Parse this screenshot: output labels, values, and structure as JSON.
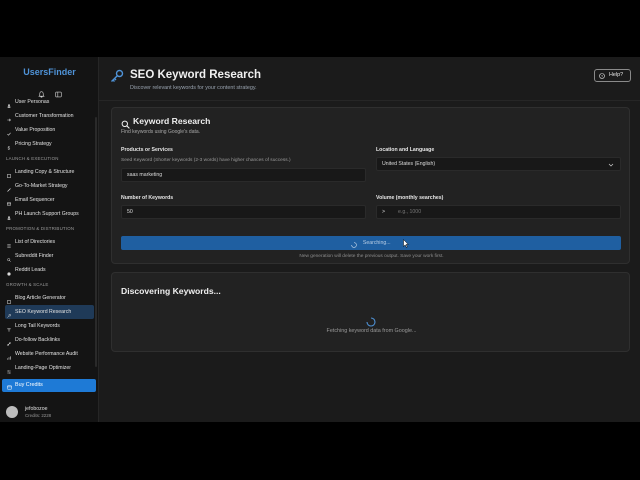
{
  "app": {
    "brand": "UsersFinder"
  },
  "sidebar": {
    "items": [
      {
        "label": "User Personas",
        "icon": "users-icon"
      },
      {
        "label": "Customer Transformation",
        "icon": "arrow-right-icon"
      },
      {
        "label": "Value Proposition",
        "icon": "check-icon"
      },
      {
        "label": "Pricing Strategy",
        "icon": "dollar-icon"
      }
    ],
    "sections": [
      {
        "title": "Launch & Execution",
        "items": [
          {
            "label": "Landing Copy & Structure",
            "icon": "layout-icon"
          },
          {
            "label": "Go-To-Market Strategy",
            "icon": "rocket-icon"
          },
          {
            "label": "Email Sequencer",
            "icon": "mail-icon"
          },
          {
            "label": "PH Launch Support Groups",
            "icon": "users-icon"
          }
        ]
      },
      {
        "title": "Promotion & Distribution",
        "items": [
          {
            "label": "List of Directories",
            "icon": "list-icon"
          },
          {
            "label": "Subreddit Finder",
            "icon": "search-icon"
          },
          {
            "label": "Reddit Leads",
            "icon": "reddit-icon"
          }
        ]
      },
      {
        "title": "Growth & Scale",
        "items": [
          {
            "label": "Blog Article Generator",
            "icon": "document-icon"
          },
          {
            "label": "SEO Keyword Research",
            "icon": "key-icon",
            "active": true
          },
          {
            "label": "Long Tail Keywords",
            "icon": "text-icon"
          },
          {
            "label": "Do-follow Backlinks",
            "icon": "link-icon"
          },
          {
            "label": "Website Performance Audit",
            "icon": "chart-icon"
          },
          {
            "label": "Landing-Page Optimizer",
            "icon": "sliders-icon"
          }
        ]
      }
    ],
    "buy_credits": "Buy Credits",
    "user": {
      "name": "jefobozoe",
      "credits": "Credits: 2228"
    }
  },
  "header": {
    "title": "SEO Keyword Research",
    "subtitle": "Discover relevant keywords for your content strategy.",
    "help": "Help?"
  },
  "form": {
    "title": "Keyword Research",
    "subtitle": "Find keywords using Google's data.",
    "products_label": "Products or Services",
    "seed_hint": "Seed Keyword (Shorter keywords (2-3 words) have higher chances of success.)",
    "seed_value": "saas marketing",
    "location_label": "Location and Language",
    "location_value": "United States (English)",
    "count_label": "Number of Keywords",
    "count_value": "50",
    "volume_label": "Volume (monthly searches)",
    "volume_operator": ">",
    "volume_placeholder": "e.g., 1000",
    "search_button": "Searching...",
    "note": "New generation will delete the previous output. Save your work first."
  },
  "results": {
    "title": "Discovering Keywords...",
    "status": "Fetching keyword data from Google..."
  },
  "colors": {
    "accent": "#1e7ad6",
    "brand": "#4f93d8",
    "active_nav": "#1f3a58"
  }
}
